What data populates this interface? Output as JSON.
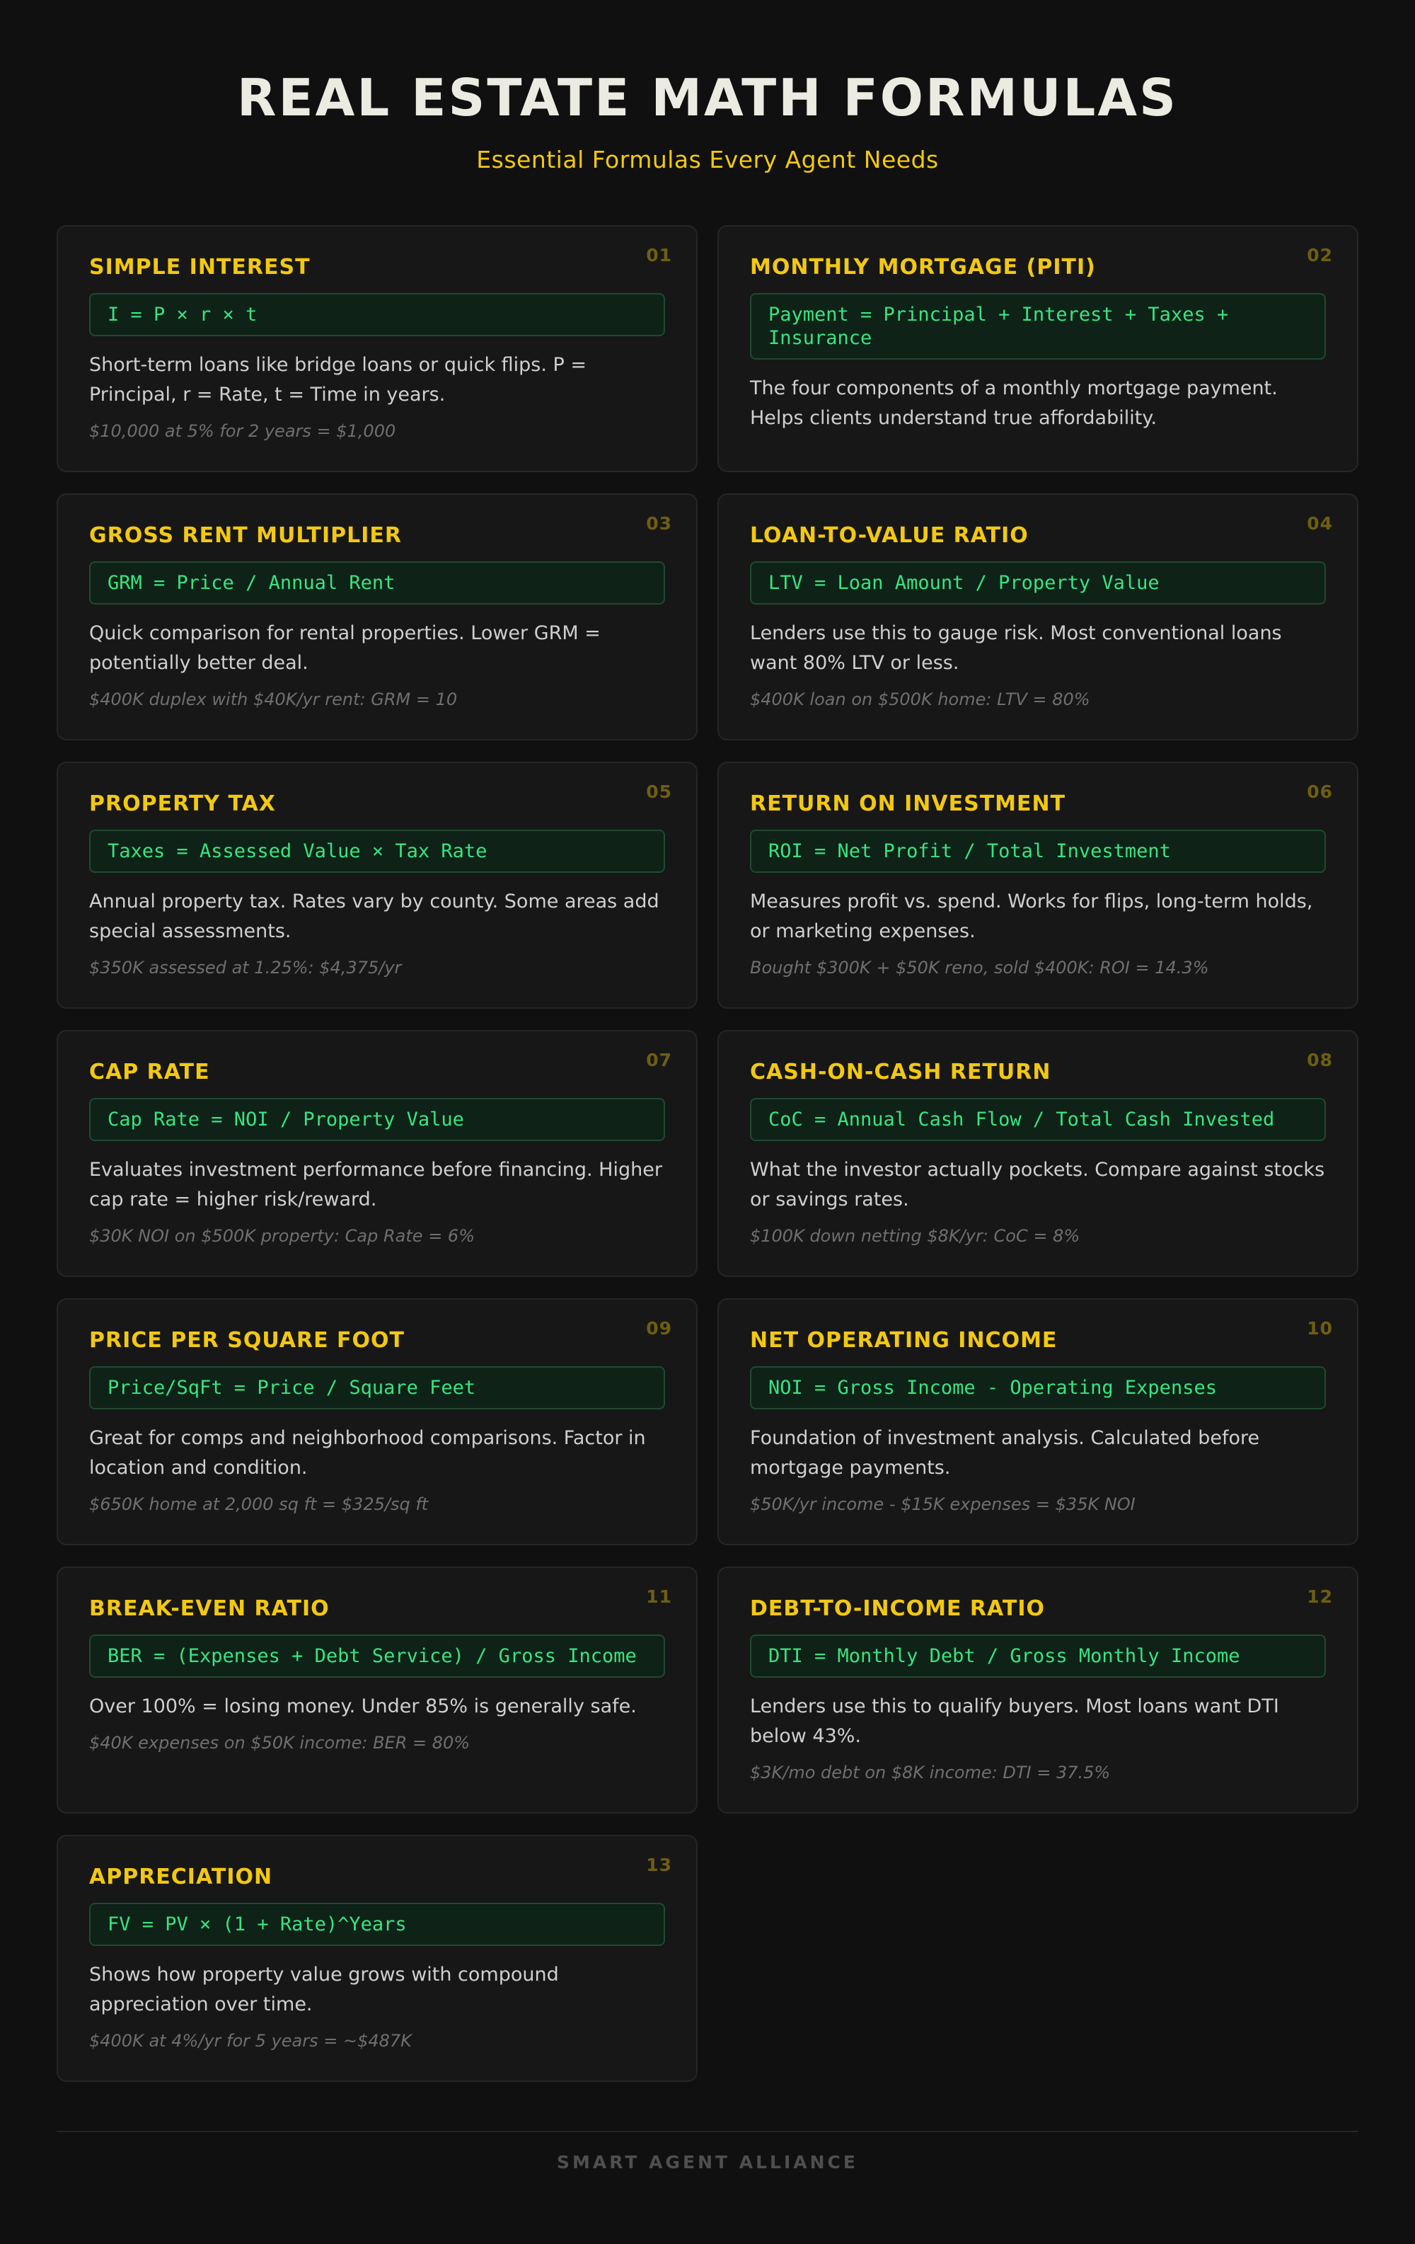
{
  "header": {
    "title": "REAL ESTATE MATH FORMULAS",
    "subtitle": "Essential Formulas Every Agent Needs"
  },
  "cards": [
    {
      "num": "01",
      "title": "SIMPLE INTEREST",
      "formula": "I = P × r × t",
      "description": "Short-term loans like bridge loans or quick flips. P = Principal, r = Rate, t = Time in years.",
      "example": "$10,000 at 5% for 2 years = $1,000"
    },
    {
      "num": "02",
      "title": "MONTHLY MORTGAGE (PITI)",
      "formula": "Payment = Principal + Interest + Taxes + Insurance",
      "description": "The four components of a monthly mortgage payment. Helps clients understand true affordability.",
      "example": ""
    },
    {
      "num": "03",
      "title": "GROSS RENT MULTIPLIER",
      "formula": "GRM = Price / Annual Rent",
      "description": "Quick comparison for rental properties. Lower GRM = potentially better deal.",
      "example": "$400K duplex with $40K/yr rent: GRM = 10"
    },
    {
      "num": "04",
      "title": "LOAN-TO-VALUE RATIO",
      "formula": "LTV = Loan Amount / Property Value",
      "description": "Lenders use this to gauge risk. Most conventional loans want 80% LTV or less.",
      "example": "$400K loan on $500K home: LTV = 80%"
    },
    {
      "num": "05",
      "title": "PROPERTY TAX",
      "formula": "Taxes = Assessed Value × Tax Rate",
      "description": "Annual property tax. Rates vary by county. Some areas add special assessments.",
      "example": "$350K assessed at 1.25%: $4,375/yr"
    },
    {
      "num": "06",
      "title": "RETURN ON INVESTMENT",
      "formula": "ROI = Net Profit / Total Investment",
      "description": "Measures profit vs. spend. Works for flips, long-term holds, or marketing expenses.",
      "example": "Bought $300K + $50K reno, sold $400K: ROI = 14.3%"
    },
    {
      "num": "07",
      "title": "CAP RATE",
      "formula": "Cap Rate = NOI / Property Value",
      "description": "Evaluates investment performance before financing. Higher cap rate = higher risk/reward.",
      "example": "$30K NOI on $500K property: Cap Rate = 6%"
    },
    {
      "num": "08",
      "title": "CASH-ON-CASH RETURN",
      "formula": "CoC = Annual Cash Flow / Total Cash Invested",
      "description": "What the investor actually pockets. Compare against stocks or savings rates.",
      "example": "$100K down netting $8K/yr: CoC = 8%"
    },
    {
      "num": "09",
      "title": "PRICE PER SQUARE FOOT",
      "formula": "Price/SqFt = Price / Square Feet",
      "description": "Great for comps and neighborhood comparisons. Factor in location and condition.",
      "example": "$650K home at 2,000 sq ft = $325/sq ft"
    },
    {
      "num": "10",
      "title": "NET OPERATING INCOME",
      "formula": "NOI = Gross Income - Operating Expenses",
      "description": "Foundation of investment analysis. Calculated before mortgage payments.",
      "example": "$50K/yr income - $15K expenses = $35K NOI"
    },
    {
      "num": "11",
      "title": "BREAK-EVEN RATIO",
      "formula": "BER = (Expenses + Debt Service) / Gross Income",
      "description": "Over 100% = losing money. Under 85% is generally safe.",
      "example": "$40K expenses on $50K income: BER = 80%"
    },
    {
      "num": "12",
      "title": "DEBT-TO-INCOME RATIO",
      "formula": "DTI = Monthly Debt / Gross Monthly Income",
      "description": "Lenders use this to qualify buyers. Most loans want DTI below 43%.",
      "example": "$3K/mo debt on $8K income: DTI = 37.5%"
    },
    {
      "num": "13",
      "title": "APPRECIATION",
      "formula": "FV = PV × (1 + Rate)^Years",
      "description": "Shows how property value grows with compound appreciation over time.",
      "example": "$400K at 4%/yr for 5 years = ~$487K"
    }
  ],
  "footer": {
    "text": "SMART AGENT ALLIANCE"
  }
}
